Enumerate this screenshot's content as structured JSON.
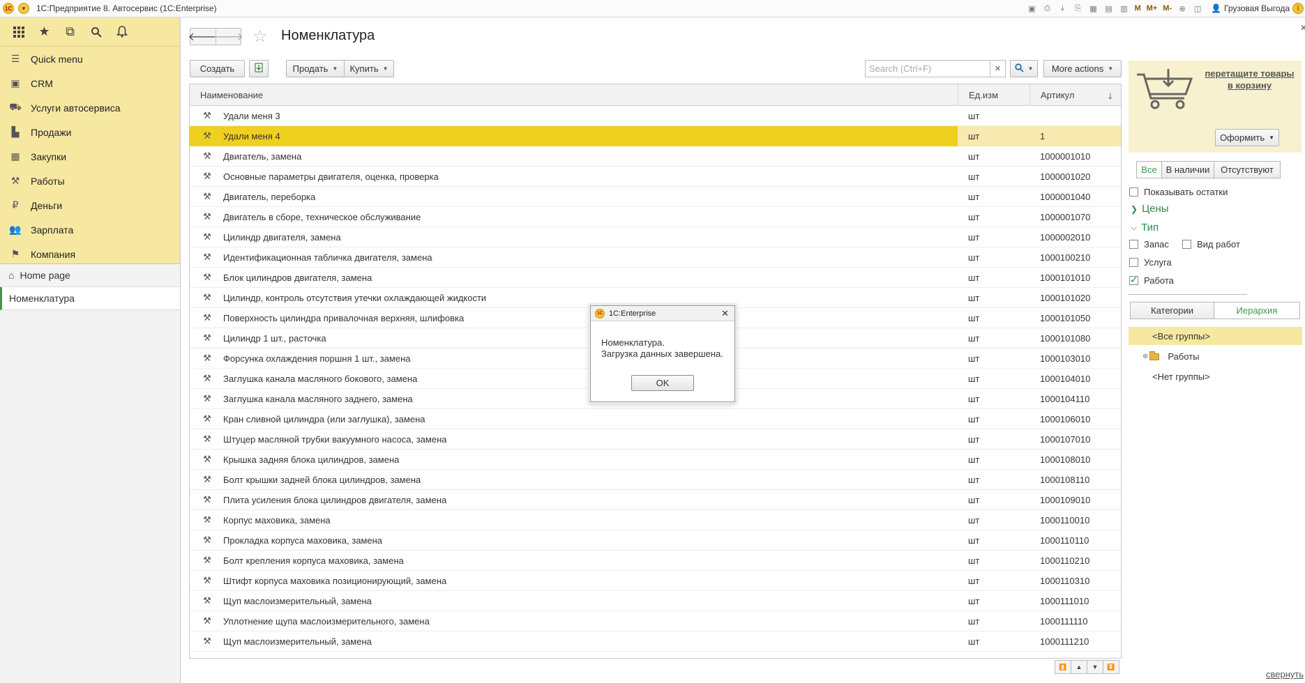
{
  "window": {
    "title": "1С:Предприятие 8. Автосервис  (1С:Enterprise)",
    "user": "Грузовая Выгода",
    "toolbar_marks": [
      "M",
      "M+",
      "M-"
    ]
  },
  "sidebar": {
    "items": [
      {
        "label": "Quick menu",
        "icon": "hamburger-icon"
      },
      {
        "label": "CRM",
        "icon": "crm-icon"
      },
      {
        "label": "Услуги автосервиса",
        "icon": "car-icon"
      },
      {
        "label": "Продажи",
        "icon": "sales-icon"
      },
      {
        "label": "Закупки",
        "icon": "purchase-icon"
      },
      {
        "label": "Работы",
        "icon": "tools-icon"
      },
      {
        "label": "Деньги",
        "icon": "money-icon"
      },
      {
        "label": "Зарплата",
        "icon": "people-icon"
      },
      {
        "label": "Компания",
        "icon": "flag-icon"
      }
    ],
    "home": "Home page",
    "open_tab": "Номенклатура"
  },
  "page": {
    "title": "Номенклатура",
    "buttons": {
      "create": "Создать",
      "sell": "Продать",
      "buy": "Купить",
      "more": "More actions"
    },
    "search_placeholder": "Search (Ctrl+F)",
    "columns": [
      "Наименование",
      "Ед.изм",
      "Артикул"
    ],
    "rows": [
      {
        "name": "Удали меня 3",
        "unit": "шт",
        "article": ""
      },
      {
        "name": "Удали меня 4",
        "unit": "шт",
        "article": "1"
      },
      {
        "name": "Двигатель, замена",
        "unit": "шт",
        "article": "1000001010"
      },
      {
        "name": "Основные параметры двигателя, оценка, проверка",
        "unit": "шт",
        "article": "1000001020"
      },
      {
        "name": "Двигатель, переборка",
        "unit": "шт",
        "article": "1000001040"
      },
      {
        "name": "Двигатель в сборе, техническое обслуживание",
        "unit": "шт",
        "article": "1000001070"
      },
      {
        "name": "Цилиндр двигателя, замена",
        "unit": "шт",
        "article": "1000002010"
      },
      {
        "name": "Идентификационная табличка двигателя, замена",
        "unit": "шт",
        "article": "1000100210"
      },
      {
        "name": "Блок цилиндров двигателя, замена",
        "unit": "шт",
        "article": "1000101010"
      },
      {
        "name": "Цилиндр, контроль отсутствия утечки охлаждающей жидкости",
        "unit": "шт",
        "article": "1000101020"
      },
      {
        "name": "Поверхность цилиндра привалочная верхняя, шлифовка",
        "unit": "шт",
        "article": "1000101050"
      },
      {
        "name": "Цилиндр 1 шт., расточка",
        "unit": "шт",
        "article": "1000101080"
      },
      {
        "name": "Форсунка охлаждения поршня 1 шт., замена",
        "unit": "шт",
        "article": "1000103010"
      },
      {
        "name": "Заглушка канала масляного бокового, замена",
        "unit": "шт",
        "article": "1000104010"
      },
      {
        "name": "Заглушка канала масляного заднего, замена",
        "unit": "шт",
        "article": "1000104110"
      },
      {
        "name": "Кран сливной цилиндра (или заглушка), замена",
        "unit": "шт",
        "article": "1000106010"
      },
      {
        "name": "Штуцер масляной трубки вакуумного насоса, замена",
        "unit": "шт",
        "article": "1000107010"
      },
      {
        "name": "Крышка задняя блока цилиндров, замена",
        "unit": "шт",
        "article": "1000108010"
      },
      {
        "name": "Болт крышки задней блока цилиндров, замена",
        "unit": "шт",
        "article": "1000108110"
      },
      {
        "name": "Плита усиления блока цилиндров двигателя, замена",
        "unit": "шт",
        "article": "1000109010"
      },
      {
        "name": "Корпус маховика, замена",
        "unit": "шт",
        "article": "1000110010"
      },
      {
        "name": "Прокладка корпуса маховика, замена",
        "unit": "шт",
        "article": "1000110110"
      },
      {
        "name": "Болт крепления корпуса маховика, замена",
        "unit": "шт",
        "article": "1000110210"
      },
      {
        "name": "Штифт корпуса маховика позиционирующий, замена",
        "unit": "шт",
        "article": "1000110310"
      },
      {
        "name": "Щуп маслоизмерительный, замена",
        "unit": "шт",
        "article": "1000111010"
      },
      {
        "name": "Уплотнение щупа маслоизмерительного, замена",
        "unit": "шт",
        "article": "1000111110"
      },
      {
        "name": "Щуп маслоизмерительный, замена",
        "unit": "шт",
        "article": "1000111210"
      }
    ],
    "selected_row_index": 1
  },
  "right_panel": {
    "cart_text": "перетащите товары в корзину",
    "checkout": "Оформить",
    "filter_tabs": [
      "Все",
      "В наличии",
      "Отсутствуют"
    ],
    "show_stock": "Показывать остатки",
    "prices_group": "Цены",
    "type_group": "Тип",
    "type_options": [
      {
        "label": "Запас",
        "checked": false
      },
      {
        "label": "Вид работ",
        "checked": false
      },
      {
        "label": "Услуга",
        "checked": false
      },
      {
        "label": "Работа",
        "checked": true
      }
    ],
    "view_tabs": [
      "Категории",
      "Иерархия"
    ],
    "tree": [
      "<Все группы>",
      "Работы",
      "<Нет группы>"
    ],
    "collapse": "свернуть"
  },
  "dialog": {
    "title": "1C:Enterprise",
    "line1": "Номенклатура.",
    "line2": "Загрузка данных завершена.",
    "ok": "OK"
  },
  "colors": {
    "sidebar_bg": "#f6e8a1",
    "selected_row": "#efcf1f",
    "accent_green": "#3a9a4a"
  }
}
